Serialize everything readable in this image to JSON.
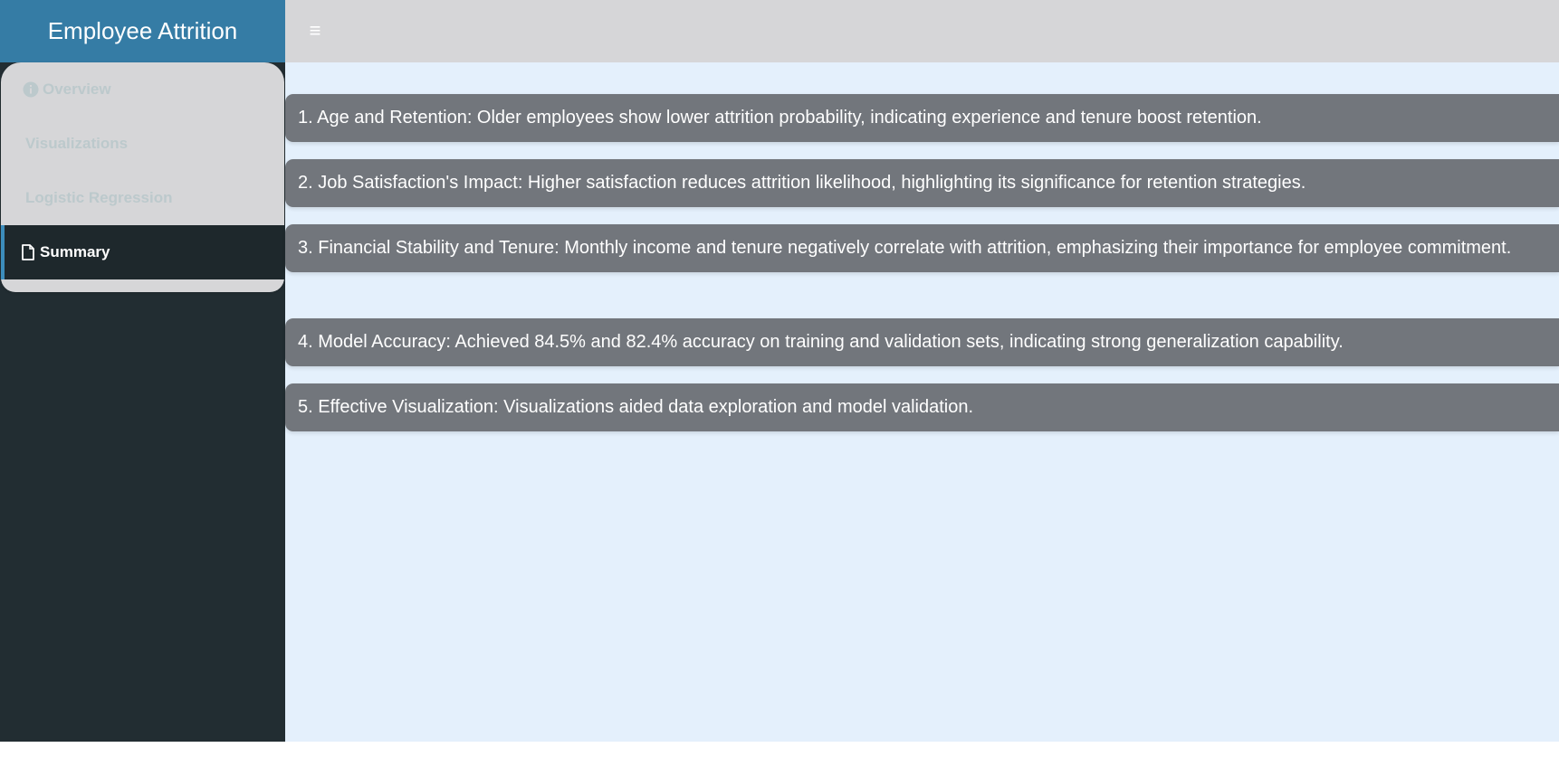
{
  "header": {
    "title": "Employee Attrition",
    "menu_toggle_icon": "hamburger-icon"
  },
  "sidebar": {
    "items": [
      {
        "label": "Overview",
        "icon": "info-circle-icon",
        "active": false
      },
      {
        "label": "Visualizations",
        "icon": "",
        "active": false
      },
      {
        "label": "Logistic Regression",
        "icon": "",
        "active": false
      },
      {
        "label": "Summary",
        "icon": "file-icon",
        "active": true
      }
    ]
  },
  "summary": {
    "points": [
      "1. Age and Retention: Older employees show lower attrition probability, indicating experience and tenure boost retention.",
      "2. Job Satisfaction's Impact: Higher satisfaction reduces attrition likelihood, highlighting its significance for retention strategies.",
      "3. Financial Stability and Tenure: Monthly income and tenure negatively correlate with attrition, emphasizing their importance for employee commitment.",
      "4. Model Accuracy: Achieved 84.5% and 82.4% accuracy on training and validation sets, indicating strong generalization capability.",
      "5. Effective Visualization: Visualizations aided data exploration and model validation."
    ]
  },
  "colors": {
    "brand": "#357ca5",
    "topbar": "#d6d6d8",
    "sidebar": "#222d32",
    "active_item": "#1e282c",
    "content_bg": "#e4f0fc",
    "box_bg": "#72767c"
  }
}
